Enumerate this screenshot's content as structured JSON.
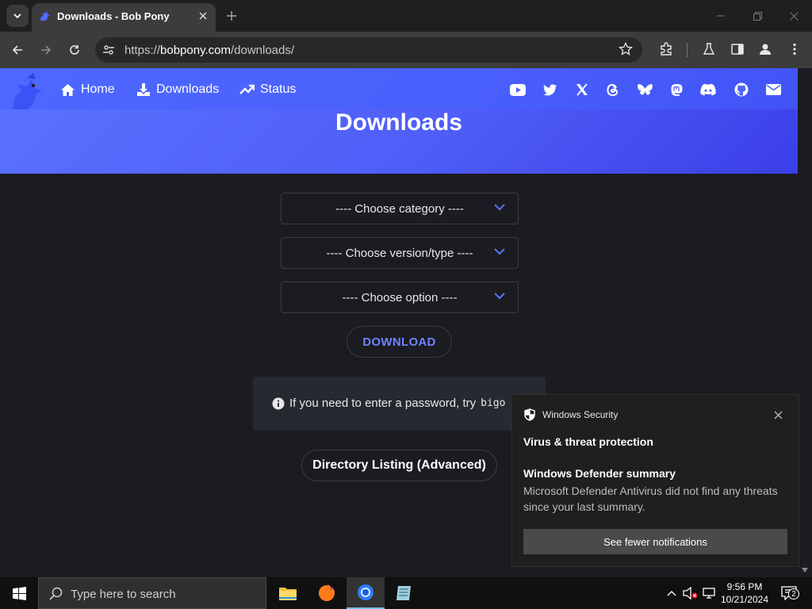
{
  "browser": {
    "tab_title": "Downloads - Bob Pony",
    "url_scheme": "https://",
    "url_host": "bobpony.com",
    "url_path": "/downloads/"
  },
  "site": {
    "nav": [
      {
        "label": "Home",
        "icon": "home-icon"
      },
      {
        "label": "Downloads",
        "icon": "download-icon"
      },
      {
        "label": "Status",
        "icon": "trend-icon"
      }
    ],
    "social_icons": [
      "youtube-icon",
      "twitter-icon",
      "x-icon",
      "threads-icon",
      "bluesky-icon",
      "mastodon-icon",
      "discord-icon",
      "github-icon",
      "email-icon"
    ],
    "page_title": "Downloads",
    "selects": {
      "category": "---- Choose category ----",
      "version": "---- Choose version/type ----",
      "option": "---- Choose option ----"
    },
    "download_label": "DOWNLOAD",
    "info_text": "If you need to enter a password, try",
    "info_code": "bigo",
    "directory_label": "Directory Listing (Advanced)",
    "accent": "#5a72ff"
  },
  "toast": {
    "app_name": "Windows Security",
    "heading": "Virus & threat protection",
    "summary_title": "Windows Defender summary",
    "summary_body": "Microsoft Defender Antivirus did not find any threats since your last summary.",
    "button_label": "See fewer notifications"
  },
  "taskbar": {
    "search_placeholder": "Type here to search",
    "time": "9:56 PM",
    "date": "10/21/2024",
    "notification_count": "2"
  }
}
